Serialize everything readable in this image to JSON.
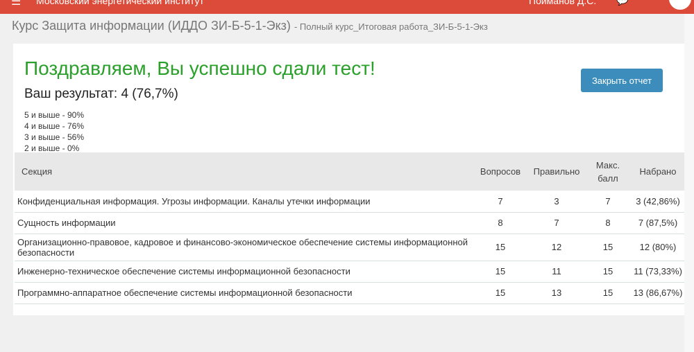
{
  "topbar": {
    "menu_icon": "hamburger-icon",
    "org": "Московский энергетический институт",
    "user": "Поиманов Д.С.",
    "chat_icon": "chat-icon"
  },
  "breadcrumb": {
    "course": "Курс Защита информации (ИДДО ЗИ-Б-5-1-Экз)",
    "sub": "- Полный курс_Итоговая работа_ЗИ-Б-5-1-Экз"
  },
  "result": {
    "title": "Поздравляем, Вы успешно сдали тест!",
    "score": "Ваш результат: 4 (76,7%)",
    "grades": [
      "5 и выше - 90%",
      "4 и выше - 76%",
      "3 и выше - 56%",
      "2 и выше - 0%"
    ],
    "close_button": "Закрыть отчет"
  },
  "table": {
    "headers": [
      "Секция",
      "Вопросов",
      "Правильно",
      "Макс. балл",
      "Набрано"
    ],
    "rows": [
      [
        "Конфиденциальная информация. Угрозы информации. Каналы утечки информации",
        "7",
        "3",
        "7",
        "3 (42,86%)"
      ],
      [
        "Сущность информации",
        "8",
        "7",
        "8",
        "7 (87,5%)"
      ],
      [
        "Организационно-правовое, кадровое и финансово-экономическое обеспечение системы информационной безопасности",
        "15",
        "12",
        "15",
        "12 (80%)"
      ],
      [
        "Инженерно-техническое обеспечение системы информационной безопасности",
        "15",
        "11",
        "15",
        "11 (73,33%)"
      ],
      [
        "Программно-аппаратное обеспечение системы информационной безопасности",
        "15",
        "13",
        "15",
        "13 (86,67%)"
      ]
    ]
  }
}
